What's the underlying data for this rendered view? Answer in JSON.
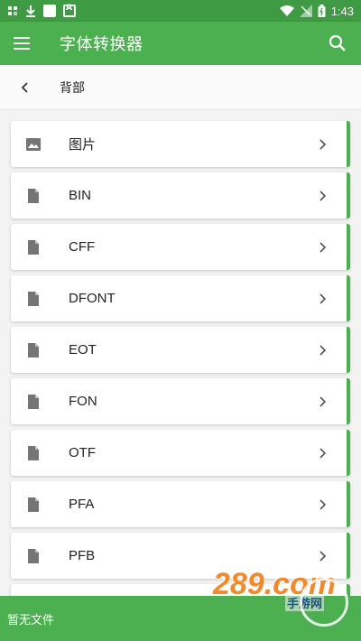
{
  "status_bar": {
    "time": "1:43",
    "left_icons": [
      "screen-icon",
      "download-icon",
      "app-square-icon",
      "a-box-icon"
    ],
    "right_icons": [
      "wifi-icon",
      "signal-icon",
      "battery-icon"
    ]
  },
  "app_bar": {
    "title": "字体转换器",
    "menu_icon": "menu-icon",
    "search_icon": "search-icon"
  },
  "breadcrumb": {
    "title": "背部",
    "back_icon": "chevron-left-icon"
  },
  "items": [
    {
      "label": "图片",
      "icon": "image-icon"
    },
    {
      "label": "BIN",
      "icon": "file-icon"
    },
    {
      "label": "CFF",
      "icon": "file-icon"
    },
    {
      "label": "DFONT",
      "icon": "file-icon"
    },
    {
      "label": "EOT",
      "icon": "file-icon"
    },
    {
      "label": "FON",
      "icon": "file-icon"
    },
    {
      "label": "OTF",
      "icon": "file-icon"
    },
    {
      "label": "PFA",
      "icon": "file-icon"
    },
    {
      "label": "PFB",
      "icon": "file-icon"
    }
  ],
  "bottom_bar": {
    "text": "暂无文件"
  },
  "watermark": {
    "text": "289.com",
    "subtext": "手游网"
  },
  "colors": {
    "primary": "#4caf50",
    "primary_dark": "#3e9a43",
    "icon_gray": "#757575",
    "watermark_orange": "#f08a2c"
  }
}
